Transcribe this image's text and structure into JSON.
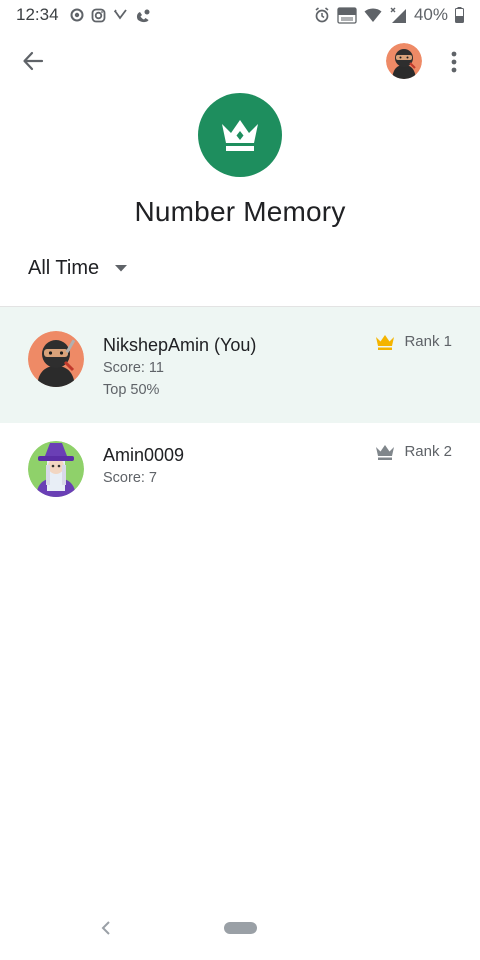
{
  "status_bar": {
    "time": "12:34",
    "battery_percent": "40%",
    "left_icons": [
      "record-icon",
      "instagram-icon",
      "missed-call-icon",
      "voicemail-icon"
    ],
    "right_icons": [
      "alarm-icon",
      "volte-icon",
      "wifi-icon",
      "signal-icon",
      "battery-icon"
    ]
  },
  "app_bar": {
    "back_icon": "arrow-left-icon",
    "more_icon": "more-vert-icon"
  },
  "game": {
    "title": "Number Memory",
    "emblem_icon": "crown-icon",
    "emblem_color": "#1e8e5e"
  },
  "filter": {
    "selected": "All Time",
    "icon": "dropdown-arrow-icon"
  },
  "leaderboard": [
    {
      "name": "NikshepAmin (You)",
      "score": "Score: 11",
      "percentile": "Top 50%",
      "rank": "Rank 1",
      "crown_color": "#f4b400",
      "highlight": true
    },
    {
      "name": "Amin0009",
      "score": "Score: 7",
      "rank": "Rank 2",
      "crown_color": "#80868b",
      "highlight": false
    }
  ],
  "colors": {
    "highlight_row": "#eef6f3",
    "accent": "#1e8e5e",
    "gold": "#f4b400"
  }
}
